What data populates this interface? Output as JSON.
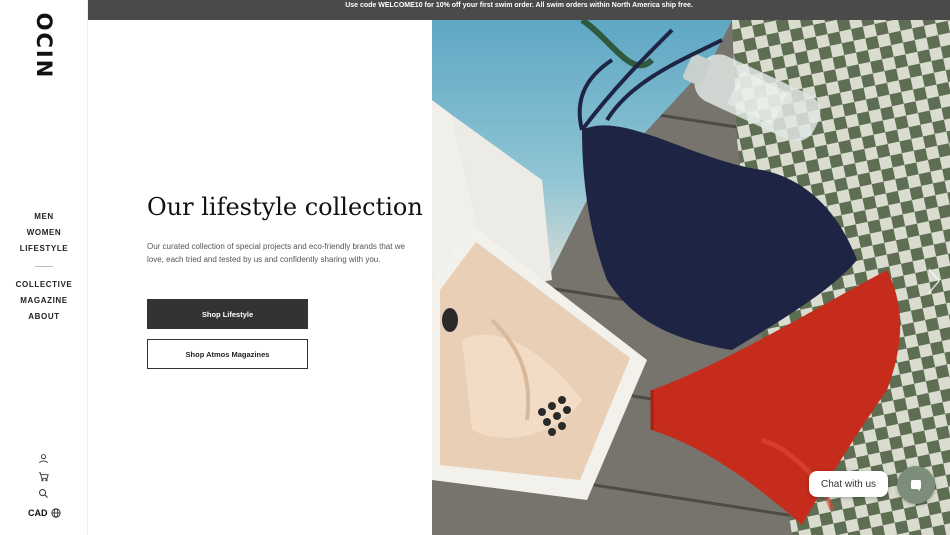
{
  "announcement": "Use code WELCOME10 for 10% off your first swim order. All swim orders within North America ship free.",
  "logo": "OCIN",
  "nav": {
    "primary": [
      "MEN",
      "WOMEN",
      "LIFESTYLE"
    ],
    "secondary": [
      "COLLECTIVE",
      "MAGAZINE",
      "ABOUT"
    ]
  },
  "utilities": {
    "account_icon": "user-icon",
    "cart_icon": "cart-icon",
    "search_icon": "search-icon",
    "currency": "CAD",
    "currency_icon": "globe-icon"
  },
  "hero": {
    "title": "Our lifestyle collection",
    "description": "Our curated collection of special projects and eco-friendly brands that we love, each tried and tested by us and confidently sharing with you.",
    "primary_button": "Shop Lifestyle",
    "secondary_button": "Shop Atmos Magazines"
  },
  "chat": {
    "label": "Chat with us",
    "icon": "chat-icon"
  },
  "colors": {
    "announcement_bg": "#4a4a4a",
    "primary_button_bg": "#333333",
    "chat_button_bg": "#7c8e79"
  }
}
